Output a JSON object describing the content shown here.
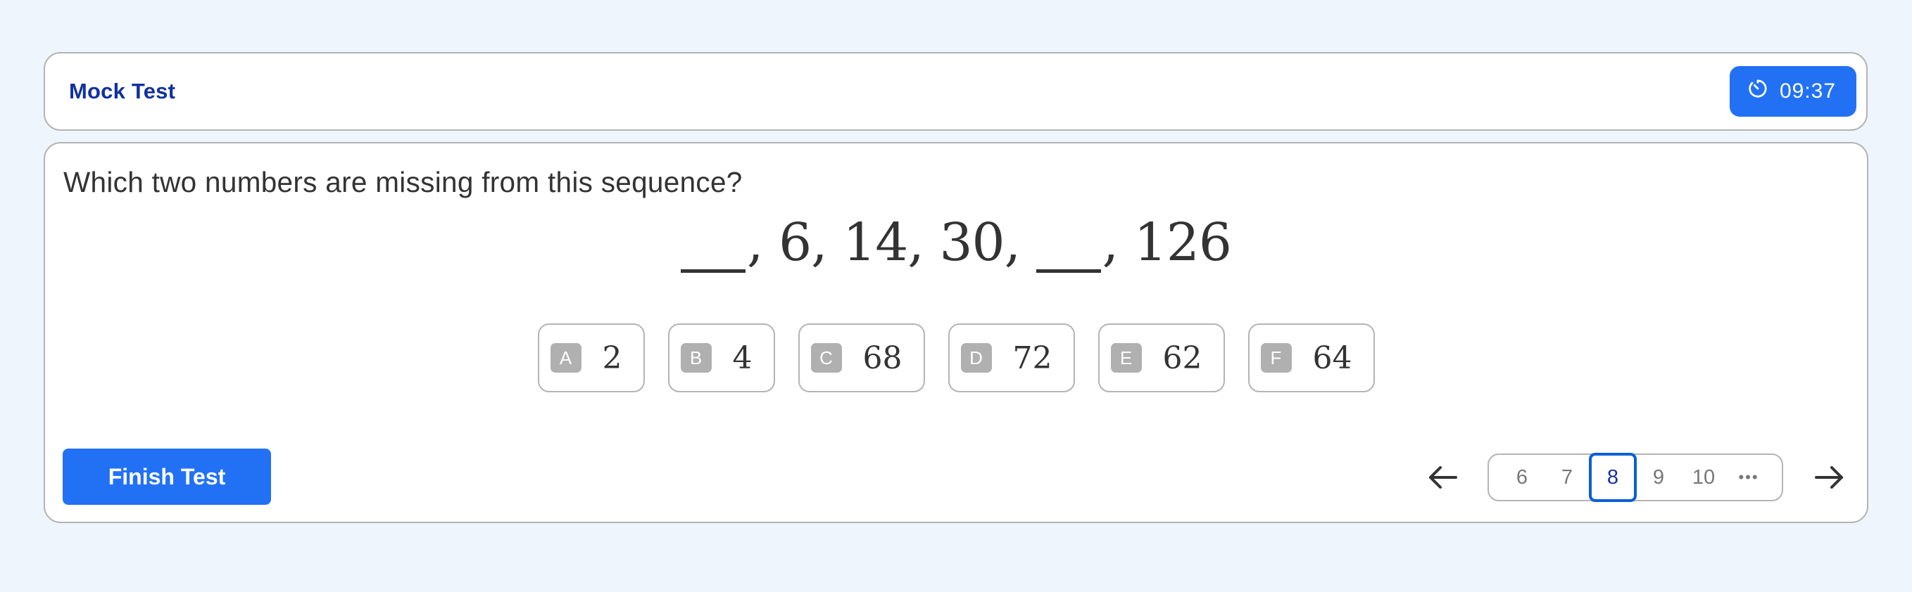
{
  "header": {
    "title": "Mock Test",
    "timer": {
      "icon": "timer-icon",
      "value": "09:37"
    }
  },
  "question": {
    "text": "Which two numbers are missing from this sequence?",
    "sequence": [
      "__",
      "6",
      "14",
      "30",
      "__",
      "126"
    ]
  },
  "options": [
    {
      "letter": "A",
      "value": "2"
    },
    {
      "letter": "B",
      "value": "4"
    },
    {
      "letter": "C",
      "value": "68"
    },
    {
      "letter": "D",
      "value": "72"
    },
    {
      "letter": "E",
      "value": "62"
    },
    {
      "letter": "F",
      "value": "64"
    }
  ],
  "footer": {
    "finish_label": "Finish Test",
    "pagination": {
      "prev_icon": "arrow-left-icon",
      "next_icon": "arrow-right-icon",
      "pages": [
        "6",
        "7",
        "8",
        "9",
        "10"
      ],
      "current": "8",
      "more": "•••"
    }
  },
  "colors": {
    "accent": "#2271F5",
    "title": "#1230A0",
    "active_page_border": "#0A5FD9",
    "background": "#EEF5FD",
    "badge": "#B0B0B0"
  }
}
